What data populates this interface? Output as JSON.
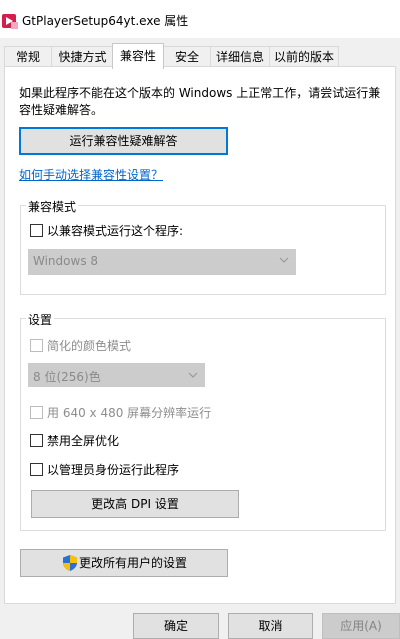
{
  "window": {
    "title": "GtPlayerSetup64yt.exe 属性"
  },
  "tabs": [
    {
      "label": "常规"
    },
    {
      "label": "快捷方式"
    },
    {
      "label": "兼容性"
    },
    {
      "label": "安全"
    },
    {
      "label": "详细信息"
    },
    {
      "label": "以前的版本"
    }
  ],
  "compat": {
    "intro_line1": "如果此程序不能在这个版本的 Windows 上正常工作，请尝试运行兼",
    "intro_line2": "容性疑难解答。",
    "troubleshoot_button": "运行兼容性疑难解答",
    "manual_link": "如何手动选择兼容性设置？",
    "mode_group": {
      "label": "兼容模式",
      "checkbox_label": "以兼容模式运行这个程序:",
      "checkbox_checked": false,
      "os_select_value": "Windows 8"
    },
    "settings_group": {
      "label": "设置",
      "reduced_color_label": "简化的颜色模式",
      "color_select_value": "8 位(256)色",
      "run_640_label": "用 640 x 480 屏幕分辨率运行",
      "disable_fullscreen_label": "禁用全屏优化",
      "run_as_admin_label": "以管理员身份运行此程序",
      "dpi_button": "更改高 DPI 设置"
    },
    "all_users_button": "更改所有用户的设置"
  },
  "footer": {
    "ok": "确定",
    "cancel": "取消",
    "apply": "应用(A)"
  }
}
